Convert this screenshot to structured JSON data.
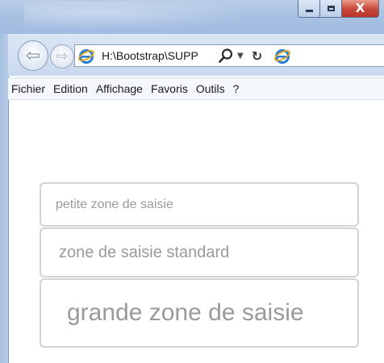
{
  "window": {
    "controls": {
      "minimize_icon": "minimize-icon",
      "maximize_icon": "maximize-icon",
      "close_glyph": "X"
    }
  },
  "navigation": {
    "back_glyph": "⇦",
    "forward_glyph": "⇨",
    "address": "H:\\Bootstrap\\SUPP",
    "search_dropdown_glyph": "▼",
    "refresh_glyph": "↻"
  },
  "menu": {
    "items": [
      "Fichier",
      "Edition",
      "Affichage",
      "Favoris",
      "Outils",
      "?"
    ]
  },
  "form": {
    "small_input_placeholder": "petite zone de saisie",
    "standard_input_placeholder": "zone de saisie standard",
    "large_input_placeholder": "grande zone de saisie"
  },
  "colors": {
    "ie_blue": "#2a7fd4",
    "ie_gold": "#e0a526",
    "input_border": "#d3d3d3",
    "placeholder": "#9a9a9a",
    "close_red": "#c8463a"
  }
}
